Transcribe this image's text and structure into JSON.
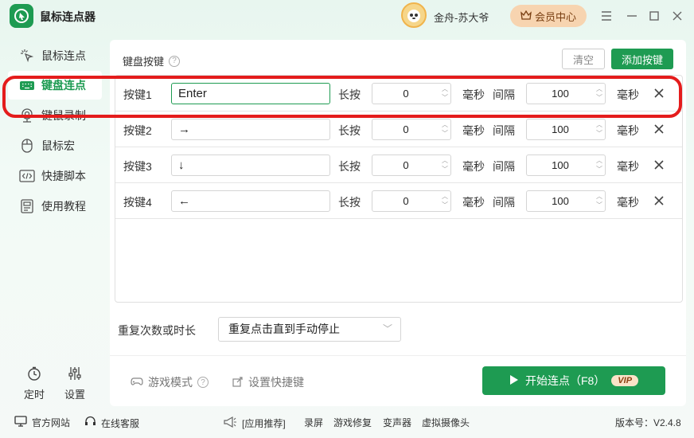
{
  "app": {
    "title": "鼠标连点器"
  },
  "user": {
    "name": "金舟-苏大爷",
    "vip_label": "会员中心"
  },
  "sidebar": {
    "items": [
      {
        "label": "鼠标连点",
        "icon": "mouse-click-icon"
      },
      {
        "label": "键盘连点",
        "icon": "keyboard-icon"
      },
      {
        "label": "键鼠录制",
        "icon": "webcam-record-icon"
      },
      {
        "label": "鼠标宏",
        "icon": "mouse-icon"
      },
      {
        "label": "快捷脚本",
        "icon": "code-icon"
      },
      {
        "label": "使用教程",
        "icon": "tutorial-icon"
      }
    ],
    "active_index": 1,
    "bottom": [
      {
        "label": "定时",
        "icon": "timer-icon"
      },
      {
        "label": "设置",
        "icon": "settings-sliders-icon"
      }
    ]
  },
  "main": {
    "section_title": "键盘按键",
    "clear_label": "清空",
    "add_label": "添加按键",
    "rows": [
      {
        "label": "按键1",
        "key": "Enter",
        "hold_label": "长按",
        "hold": "0",
        "unit": "毫秒",
        "interval_label": "间隔",
        "interval": "100",
        "unit2": "毫秒"
      },
      {
        "label": "按键2",
        "key": "→",
        "hold_label": "长按",
        "hold": "0",
        "unit": "毫秒",
        "interval_label": "间隔",
        "interval": "100",
        "unit2": "毫秒"
      },
      {
        "label": "按键3",
        "key": "↓",
        "hold_label": "长按",
        "hold": "0",
        "unit": "毫秒",
        "interval_label": "间隔",
        "interval": "100",
        "unit2": "毫秒"
      },
      {
        "label": "按键4",
        "key": "←",
        "hold_label": "长按",
        "hold": "0",
        "unit": "毫秒",
        "interval_label": "间隔",
        "interval": "100",
        "unit2": "毫秒"
      }
    ],
    "repeat_label": "重复次数或时长",
    "repeat_value": "重复点击直到手动停止",
    "game_mode_label": "游戏模式",
    "hotkey_label": "设置快捷键",
    "start_label": "开始连点（F8）",
    "vip_tag": "VIP"
  },
  "statusbar": {
    "website": "官方网站",
    "service": "在线客服",
    "recommend": "[应用推荐]",
    "links": [
      "录屏",
      "游戏修复",
      "变声器",
      "虚拟摄像头"
    ],
    "version": "版本号：V2.4.8"
  },
  "colors": {
    "accent": "#1e9b52",
    "highlight": "#e41c1c",
    "vip_bg": "#f7d4b0"
  }
}
